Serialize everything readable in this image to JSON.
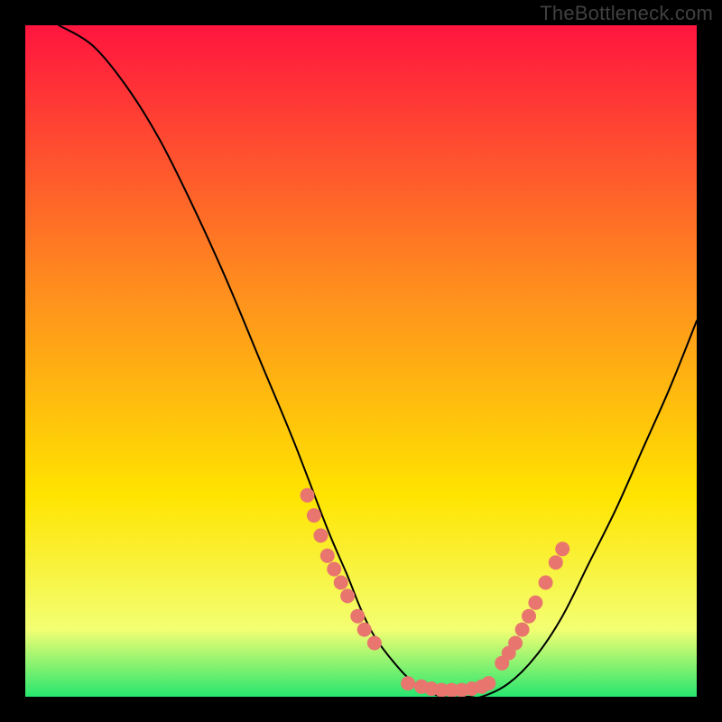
{
  "watermark": "TheBottleneck.com",
  "colors": {
    "background": "#000000",
    "gradient_top": "#ff153f",
    "gradient_mid1": "#ff8a1f",
    "gradient_mid2": "#ffe400",
    "gradient_low": "#f3ff72",
    "gradient_bottom": "#27e66f",
    "curve": "#000000",
    "marker": "#e8766f"
  },
  "chart_data": {
    "type": "line",
    "title": "",
    "xlabel": "",
    "ylabel": "",
    "xlim": [
      0,
      100
    ],
    "ylim": [
      0,
      100
    ],
    "grid": false,
    "legend": false,
    "series": [
      {
        "name": "bottleneck-curve",
        "x": [
          5,
          10,
          15,
          20,
          25,
          30,
          35,
          40,
          45,
          48,
          50,
          52,
          55,
          58,
          62,
          66,
          68,
          72,
          76,
          80,
          84,
          88,
          92,
          96,
          100
        ],
        "y": [
          100,
          97,
          91,
          83,
          73,
          62,
          50,
          38,
          25,
          18,
          13,
          9,
          5,
          2,
          0,
          0,
          0,
          2,
          6,
          12,
          20,
          28,
          37,
          46,
          56
        ]
      }
    ],
    "marker_clusters": [
      {
        "name": "left-slope-markers",
        "points": [
          {
            "x": 42,
            "y": 30
          },
          {
            "x": 43,
            "y": 27
          },
          {
            "x": 44,
            "y": 24
          },
          {
            "x": 45,
            "y": 21
          },
          {
            "x": 46,
            "y": 19
          },
          {
            "x": 47,
            "y": 17
          },
          {
            "x": 48,
            "y": 15
          },
          {
            "x": 49.5,
            "y": 12
          },
          {
            "x": 50.5,
            "y": 10
          },
          {
            "x": 52,
            "y": 8
          }
        ]
      },
      {
        "name": "bottom-flat-markers",
        "points": [
          {
            "x": 57,
            "y": 2
          },
          {
            "x": 59,
            "y": 1.5
          },
          {
            "x": 60.5,
            "y": 1.2
          },
          {
            "x": 62,
            "y": 1
          },
          {
            "x": 63.5,
            "y": 1
          },
          {
            "x": 65,
            "y": 1
          },
          {
            "x": 66.5,
            "y": 1.2
          },
          {
            "x": 68,
            "y": 1.5
          },
          {
            "x": 69,
            "y": 2
          }
        ]
      },
      {
        "name": "right-slope-markers",
        "points": [
          {
            "x": 71,
            "y": 5
          },
          {
            "x": 72,
            "y": 6.5
          },
          {
            "x": 73,
            "y": 8
          },
          {
            "x": 74,
            "y": 10
          },
          {
            "x": 75,
            "y": 12
          },
          {
            "x": 76,
            "y": 14
          },
          {
            "x": 77.5,
            "y": 17
          },
          {
            "x": 79,
            "y": 20
          },
          {
            "x": 80,
            "y": 22
          }
        ]
      }
    ]
  }
}
